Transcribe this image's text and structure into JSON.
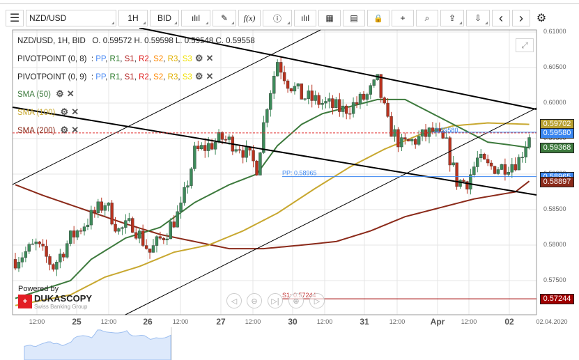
{
  "toolbar": {
    "menu": "☰",
    "symbol": "NZD/USD",
    "timeframe": "1H",
    "side": "BID",
    "draw": "✎",
    "fx": "f(x)",
    "info": "ⓘ",
    "volume": "ılıl",
    "calendar": "▦",
    "report": "▤",
    "lock": "🔒",
    "cursor": "+",
    "zoom": "⌕",
    "upload": "⇪",
    "download": "⇩",
    "prev": "‹",
    "next": "›",
    "settings": "⚙"
  },
  "header": {
    "title": "NZD/USD, 1H, BID",
    "ohlc": "O. 0.59572 H. 0.59598 L. 0:59548 C. 0.59558"
  },
  "indicators": [
    {
      "name": "PIVOTPOINT (0, 8)",
      "levels": [
        {
          "t": "PP",
          "c": "#4a8af4"
        },
        {
          "t": "R1",
          "c": "#2a7a2a"
        },
        {
          "t": "S1",
          "c": "#b02020"
        },
        {
          "t": "R2",
          "c": "#e02020"
        },
        {
          "t": "S2",
          "c": "#ff8800"
        },
        {
          "t": "R3",
          "c": "#e0b000"
        },
        {
          "t": "S3",
          "c": "#f0e000"
        }
      ]
    },
    {
      "name": "PIVOTPOINT (0, 9)",
      "levels": [
        {
          "t": "PP",
          "c": "#4a8af4"
        },
        {
          "t": "R1",
          "c": "#2a7a2a"
        },
        {
          "t": "S1",
          "c": "#b02020"
        },
        {
          "t": "R2",
          "c": "#e02020"
        },
        {
          "t": "S2",
          "c": "#ff8800"
        },
        {
          "t": "R3",
          "c": "#e0b000"
        },
        {
          "t": "S3",
          "c": "#f0e000"
        }
      ]
    }
  ],
  "sma": [
    {
      "label": "SMA (50)",
      "color": "#3d7a3d"
    },
    {
      "label": "SMA (100)",
      "color": "#c8a830"
    },
    {
      "label": "SMA (200)",
      "color": "#8b2a1a"
    }
  ],
  "y_axis": [
    "0.61000",
    "0.60500",
    "0.60000",
    "0.59500",
    "0.59000",
    "0.58500",
    "0.58000",
    "0.57500"
  ],
  "price_labels": [
    {
      "v": "0.59702",
      "bg": "#b8a030",
      "p": 0.59702
    },
    {
      "v": "0.59580",
      "bg": "#3a86f0",
      "p": 0.5958
    },
    {
      "v": "0.59368",
      "bg": "#3d7a3d",
      "p": 0.59368
    },
    {
      "v": "0.58965",
      "bg": "#3a86f0",
      "p": 0.58965
    },
    {
      "v": "0.58897",
      "bg": "#8b2a1a",
      "p": 0.58897
    },
    {
      "v": "0.57244",
      "bg": "#a00000",
      "p": 0.57244
    }
  ],
  "chart_labels": {
    "pp": "PP: 0.58965",
    "s1": "S1: 0.57244",
    "last": "0.59580"
  },
  "x_axis": [
    {
      "t": "12:00",
      "b": false
    },
    {
      "t": "25",
      "b": true
    },
    {
      "t": "12:00",
      "b": false
    },
    {
      "t": "26",
      "b": true
    },
    {
      "t": "12:00",
      "b": false
    },
    {
      "t": "27",
      "b": true
    },
    {
      "t": "12:00",
      "b": false
    },
    {
      "t": "30",
      "b": true
    },
    {
      "t": "12:00",
      "b": false
    },
    {
      "t": "31",
      "b": true
    },
    {
      "t": "12:00",
      "b": false
    },
    {
      "t": "Apr",
      "b": true
    },
    {
      "t": "12:00",
      "b": false
    },
    {
      "t": "02",
      "b": true
    },
    {
      "t": "02.04.2020",
      "b": false
    }
  ],
  "brand": {
    "powered": "Powered by",
    "name": "DUKASCOPY",
    "tagline": "Swiss Banking Group"
  },
  "chart_data": {
    "type": "candlestick",
    "candles": 150,
    "price_keypoints": [
      [
        0,
        0.578
      ],
      [
        6,
        0.58
      ],
      [
        11,
        0.577
      ],
      [
        16,
        0.581
      ],
      [
        22,
        0.584
      ],
      [
        26,
        0.586
      ],
      [
        30,
        0.582
      ],
      [
        34,
        0.583
      ],
      [
        39,
        0.579
      ],
      [
        44,
        0.582
      ],
      [
        48,
        0.585
      ],
      [
        52,
        0.593
      ],
      [
        56,
        0.594
      ],
      [
        60,
        0.595
      ],
      [
        65,
        0.594
      ],
      [
        70,
        0.591
      ],
      [
        73,
        0.6
      ],
      [
        76,
        0.606
      ],
      [
        79,
        0.603
      ],
      [
        83,
        0.601
      ],
      [
        89,
        0.6
      ],
      [
        95,
        0.599
      ],
      [
        99,
        0.6
      ],
      [
        102,
        0.601
      ],
      [
        105,
        0.603
      ],
      [
        108,
        0.597
      ],
      [
        112,
        0.594
      ],
      [
        117,
        0.595
      ],
      [
        121,
        0.596
      ],
      [
        125,
        0.594
      ],
      [
        128,
        0.589
      ],
      [
        131,
        0.589
      ],
      [
        134,
        0.592
      ],
      [
        137,
        0.591
      ],
      [
        141,
        0.591
      ],
      [
        146,
        0.592
      ],
      [
        149,
        0.5956
      ]
    ],
    "sma50": [
      [
        0,
        0.5725
      ],
      [
        16,
        0.575
      ],
      [
        22,
        0.578
      ],
      [
        32,
        0.581
      ],
      [
        42,
        0.5825
      ],
      [
        52,
        0.586
      ],
      [
        62,
        0.5885
      ],
      [
        70,
        0.59
      ],
      [
        76,
        0.594
      ],
      [
        83,
        0.597
      ],
      [
        89,
        0.5985
      ],
      [
        97,
        0.5995
      ],
      [
        105,
        0.6005
      ],
      [
        113,
        0.6005
      ],
      [
        121,
        0.5985
      ],
      [
        129,
        0.5965
      ],
      [
        137,
        0.5945
      ],
      [
        145,
        0.594
      ],
      [
        149,
        0.5937
      ]
    ],
    "sma100": [
      [
        0,
        0.5715
      ],
      [
        16,
        0.573
      ],
      [
        26,
        0.5755
      ],
      [
        36,
        0.577
      ],
      [
        46,
        0.579
      ],
      [
        56,
        0.58
      ],
      [
        66,
        0.582
      ],
      [
        76,
        0.5845
      ],
      [
        87,
        0.588
      ],
      [
        97,
        0.591
      ],
      [
        107,
        0.5935
      ],
      [
        117,
        0.5955
      ],
      [
        127,
        0.5968
      ],
      [
        137,
        0.5972
      ],
      [
        149,
        0.597
      ]
    ],
    "sma200": [
      [
        0,
        0.5885
      ],
      [
        8,
        0.587
      ],
      [
        20,
        0.585
      ],
      [
        32,
        0.583
      ],
      [
        42,
        0.5815
      ],
      [
        52,
        0.5805
      ],
      [
        62,
        0.5795
      ],
      [
        72,
        0.5795
      ],
      [
        83,
        0.58
      ],
      [
        93,
        0.5805
      ],
      [
        103,
        0.582
      ],
      [
        113,
        0.584
      ],
      [
        121,
        0.585
      ],
      [
        133,
        0.5865
      ],
      [
        145,
        0.5875
      ],
      [
        149,
        0.589
      ]
    ],
    "ylim": [
      0.5705,
      0.6105
    ]
  }
}
